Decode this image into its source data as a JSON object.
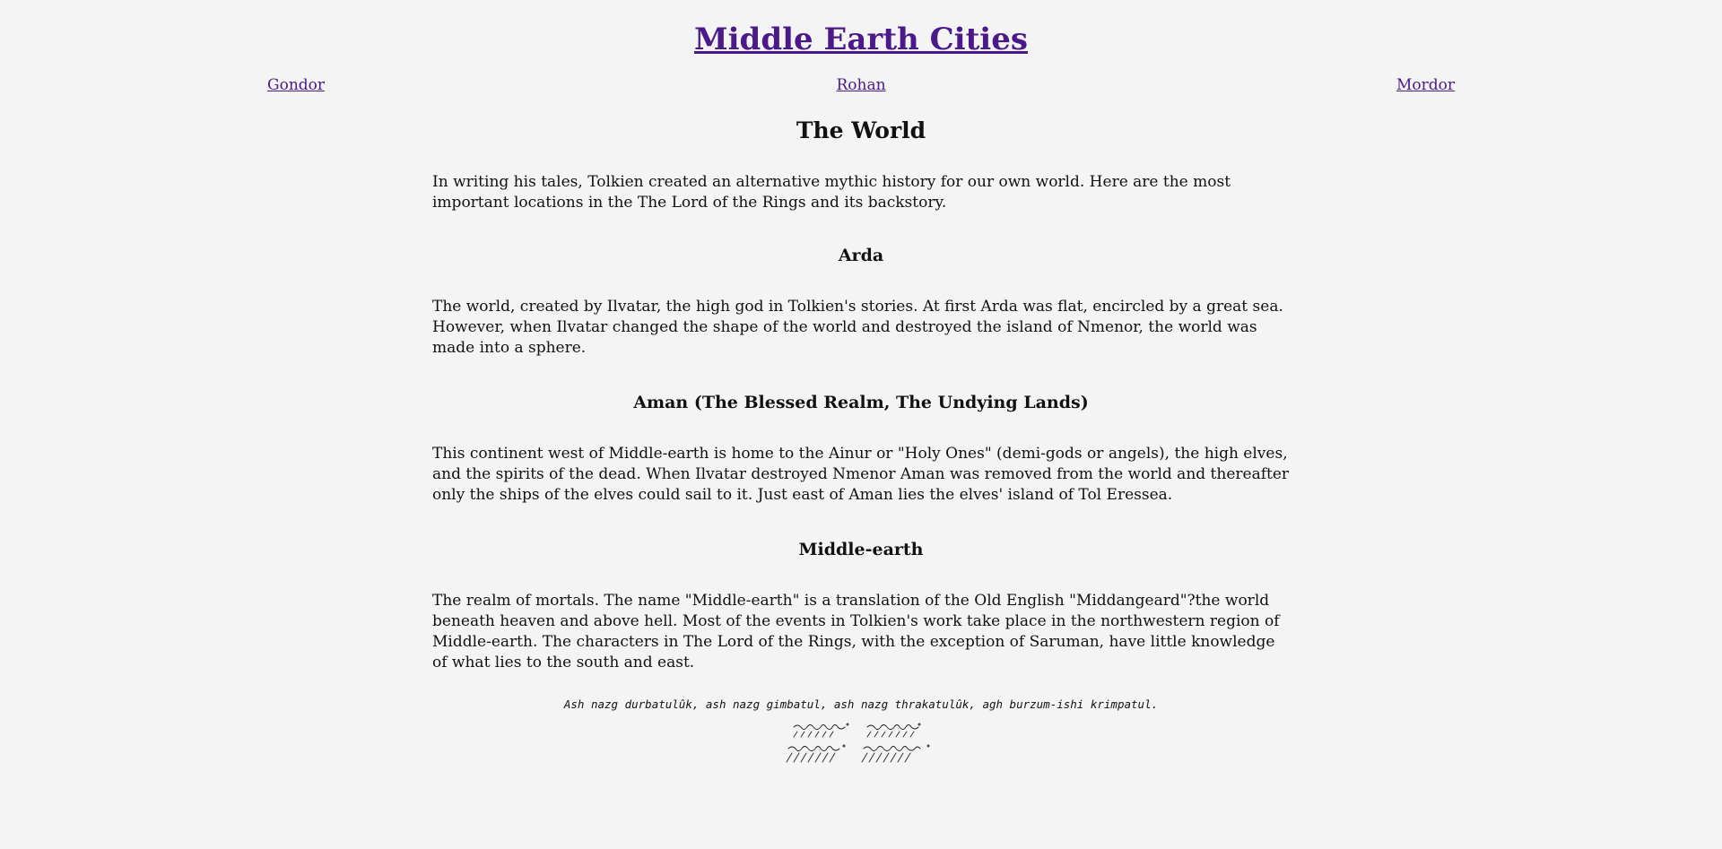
{
  "header": {
    "title": "Middle Earth Cities"
  },
  "nav": {
    "items": [
      {
        "label": "Gondor"
      },
      {
        "label": "Rohan"
      },
      {
        "label": "Mordor"
      }
    ]
  },
  "main": {
    "heading": "The World",
    "intro": "In writing his tales, Tolkien created an alternative mythic history for our own world. Here are the most important locations in the The Lord of the Rings and its backstory.",
    "sections": [
      {
        "title": "Arda",
        "text": "The world, created by Ilvatar, the high god in Tolkien's stories. At first Arda was flat, encircled by a great sea. However, when Ilvatar changed the shape of the world and destroyed the island of Nmenor, the world was made into a sphere."
      },
      {
        "title": "Aman (The Blessed Realm, The Undying Lands)",
        "text": "This continent west of Middle-earth is home to the Ainur or \"Holy Ones\" (demi-gods or angels), the high elves, and the spirits of the dead. When Ilvatar destroyed Nmenor Aman was removed from the world and thereafter only the ships of the elves could sail to it. Just east of Aman lies the elves' island of Tol Eressea."
      },
      {
        "title": "Middle-earth",
        "text": "The realm of mortals. The name \"Middle-earth\" is a translation of the Old English \"Middangeard\"?the world beneath heaven and above hell. Most of the events in Tolkien's work take place in the northwestern region of Middle-earth. The characters in The Lord of the Rings, with the exception of Saruman, have little knowledge of what lies to the south and east."
      }
    ]
  },
  "footer": {
    "quote": "Ash nazg durbatulûk, ash nazg gimbatul, ash nazg thrakatulûk, agh burzum-ishi krimpatul.",
    "inscription_icon": "tengwar-inscription-image"
  },
  "colors": {
    "background": "#f4f4f5",
    "link": "#4b1a8a",
    "text": "#111111"
  }
}
